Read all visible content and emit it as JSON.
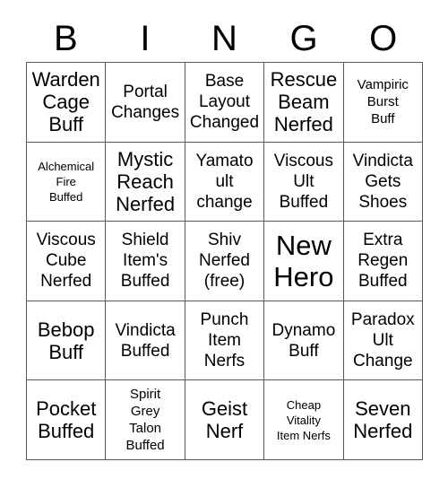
{
  "card": {
    "header_letters": [
      "B",
      "I",
      "N",
      "G",
      "O"
    ],
    "rows": [
      [
        {
          "text": "Warden\nCage\nBuff",
          "size": "lg"
        },
        {
          "text": "Portal\nChanges",
          "size": "md"
        },
        {
          "text": "Base\nLayout\nChanged",
          "size": "md"
        },
        {
          "text": "Rescue\nBeam\nNerfed",
          "size": "lg"
        },
        {
          "text": "Vampiric\nBurst\nBuff",
          "size": "sm"
        }
      ],
      [
        {
          "text": "Alchemical\nFire\nBuffed",
          "size": "xs"
        },
        {
          "text": "Mystic\nReach\nNerfed",
          "size": "lg"
        },
        {
          "text": "Yamato\nult\nchange",
          "size": "md"
        },
        {
          "text": "Viscous\nUlt\nBuffed",
          "size": "md"
        },
        {
          "text": "Vindicta\nGets\nShoes",
          "size": "md"
        }
      ],
      [
        {
          "text": "Viscous\nCube\nNerfed",
          "size": "md"
        },
        {
          "text": "Shield\nItem's\nBuffed",
          "size": "md"
        },
        {
          "text": "Shiv\nNerfed\n(free)",
          "size": "md"
        },
        {
          "text": "New\nHero",
          "size": "xl"
        },
        {
          "text": "Extra\nRegen\nBuffed",
          "size": "md"
        }
      ],
      [
        {
          "text": "Bebop\nBuff",
          "size": "lg"
        },
        {
          "text": "Vindicta\nBuffed",
          "size": "md"
        },
        {
          "text": "Punch\nItem\nNerfs",
          "size": "md"
        },
        {
          "text": "Dynamo\nBuff",
          "size": "md"
        },
        {
          "text": "Paradox\nUlt\nChange",
          "size": "md"
        }
      ],
      [
        {
          "text": "Pocket\nBuffed",
          "size": "lg"
        },
        {
          "text": "Spirit\nGrey\nTalon\nBuffed",
          "size": "sm"
        },
        {
          "text": "Geist\nNerf",
          "size": "lg"
        },
        {
          "text": "Cheap\nVitality\nItem Nerfs",
          "size": "xs"
        },
        {
          "text": "Seven\nNerfed",
          "size": "lg"
        }
      ]
    ]
  },
  "colors": {
    "background": "#ffffff",
    "text": "#000000",
    "grid_line": "#595959"
  }
}
